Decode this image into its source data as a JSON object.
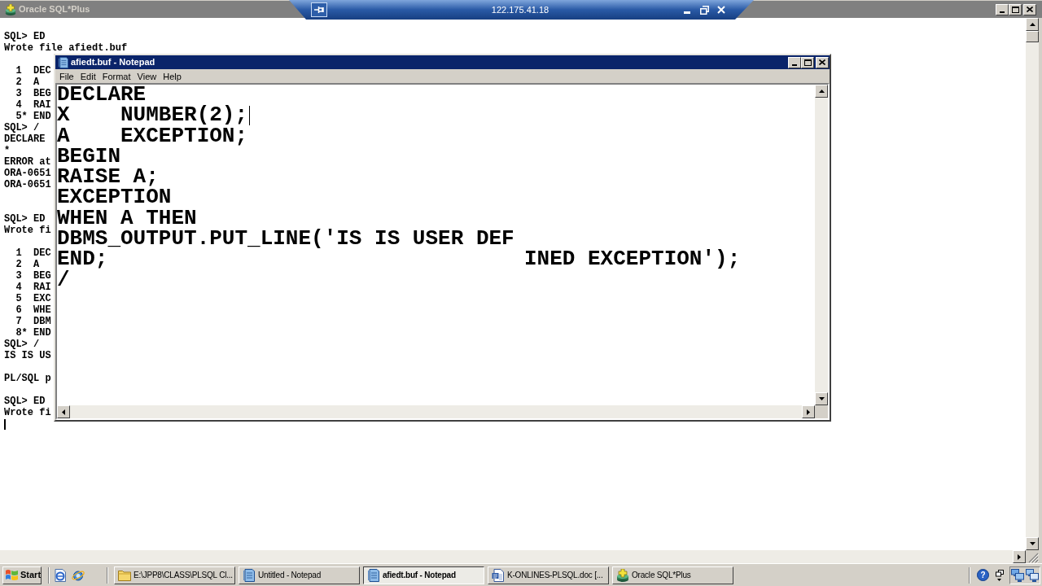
{
  "sqlplus_window": {
    "title": "Oracle SQL*Plus",
    "active": false,
    "console_lines": [
      {
        "kind": "text",
        "text": "SQL> ED"
      },
      {
        "kind": "text",
        "text": "Wrote file afiedt.buf"
      },
      {
        "kind": "blank"
      },
      {
        "kind": "listing",
        "number": "1",
        "text": "DEC"
      },
      {
        "kind": "listing",
        "number": "2",
        "text": "A"
      },
      {
        "kind": "listing",
        "number": "3",
        "text": "BEG"
      },
      {
        "kind": "listing",
        "number": "4",
        "text": "RAI"
      },
      {
        "kind": "listing",
        "number": "5*",
        "text": "END"
      },
      {
        "kind": "text",
        "text": "SQL> /"
      },
      {
        "kind": "text",
        "text": "DECLARE"
      },
      {
        "kind": "text",
        "text": "*"
      },
      {
        "kind": "text",
        "text": "ERROR at"
      },
      {
        "kind": "text",
        "text": "ORA-0651"
      },
      {
        "kind": "text",
        "text": "ORA-0651"
      },
      {
        "kind": "blank"
      },
      {
        "kind": "blank"
      },
      {
        "kind": "text",
        "text": "SQL> ED"
      },
      {
        "kind": "text",
        "text": "Wrote fi"
      },
      {
        "kind": "blank"
      },
      {
        "kind": "listing",
        "number": "1",
        "text": "DEC"
      },
      {
        "kind": "listing",
        "number": "2",
        "text": "A"
      },
      {
        "kind": "listing",
        "number": "3",
        "text": "BEG"
      },
      {
        "kind": "listing",
        "number": "4",
        "text": "RAI"
      },
      {
        "kind": "listing",
        "number": "5",
        "text": "EXC"
      },
      {
        "kind": "listing",
        "number": "6",
        "text": "WHE"
      },
      {
        "kind": "listing",
        "number": "7",
        "text": "DBM"
      },
      {
        "kind": "listing",
        "number": "8*",
        "text": "END"
      },
      {
        "kind": "text",
        "text": "SQL> /"
      },
      {
        "kind": "text",
        "text": "IS IS US"
      },
      {
        "kind": "blank"
      },
      {
        "kind": "text",
        "text": "PL/SQL p"
      },
      {
        "kind": "blank"
      },
      {
        "kind": "text",
        "text": "SQL> ED"
      },
      {
        "kind": "text",
        "text": "Wrote fi"
      },
      {
        "kind": "caret"
      }
    ]
  },
  "connection_bar": {
    "address": "122.175.41.18"
  },
  "notepad": {
    "title": "afiedt.buf - Notepad",
    "active": true,
    "menu": [
      "File",
      "Edit",
      "Format",
      "View",
      "Help"
    ],
    "lines": [
      {
        "segments": [
          "DECLARE"
        ],
        "caret": false
      },
      {
        "segments": [
          "X    NUMBER(2);"
        ],
        "caret": true
      },
      {
        "segments": [
          "A    EXCEPTION;"
        ],
        "caret": false
      },
      {
        "segments": [
          "BEGIN"
        ],
        "caret": false
      },
      {
        "segments": [
          "RAISE A;"
        ],
        "caret": false
      },
      {
        "segments": [
          "EXCEPTION"
        ],
        "caret": false
      },
      {
        "segments": [
          "WHEN A THEN"
        ],
        "caret": false
      },
      {
        "segments": [
          "DBMS_OUTPUT.PUT_LINE('IS IS USER DEF"
        ],
        "caret": false
      },
      {
        "segments": [
          "END;",
          "INED EXCEPTION');"
        ],
        "caret": false
      },
      {
        "segments": [
          "/"
        ],
        "caret": false
      }
    ]
  },
  "taskbar": {
    "start": "Start",
    "tasks": [
      {
        "kind": "folder",
        "label": "E:\\JPP8\\CLASS\\PLSQL Cl...",
        "selected": false
      },
      {
        "kind": "notepad",
        "label": "Untitled - Notepad",
        "selected": false
      },
      {
        "kind": "notepad",
        "label": "afiedt.buf - Notepad",
        "selected": true
      },
      {
        "kind": "document",
        "label": "K-ONLINES-PLSQL.doc [...",
        "selected": false
      },
      {
        "kind": "sqlplus",
        "label": "Oracle SQL*Plus",
        "selected": false
      }
    ],
    "help": "?"
  }
}
